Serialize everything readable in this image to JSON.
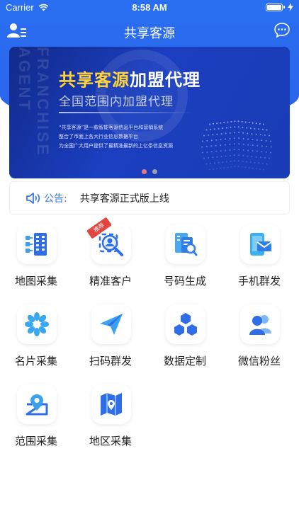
{
  "status_bar": {
    "carrier": "Carrier",
    "time": "8:58 AM",
    "battery_level": 1.0
  },
  "nav": {
    "title": "共享客源",
    "left_icon": "user-list-icon",
    "right_icon": "chat-bubble-icon"
  },
  "banner": {
    "title_highlight": "共享客源",
    "title_rest": "加盟代理",
    "subtitle": "全国范围内加盟代理",
    "vertical_text": "FRANCHISE AGENT",
    "desc_line1": "“共享客源”是一款智能客源信息平台和营销系统",
    "desc_line2": "整合了市面上各大行业信息数据平台",
    "desc_line3": "为全国广大用户提供了最精准最新的上亿条信息资源",
    "pager_count": 2,
    "pager_active": 0
  },
  "notice": {
    "icon": "speaker-icon",
    "label": "公告:",
    "text": "共享客源正式版上线"
  },
  "grid": [
    {
      "label": "地图采集",
      "icon": "map-collect-icon",
      "color": "#2f7be8"
    },
    {
      "label": "精准客户",
      "icon": "precise-customer-icon",
      "color": "#2f7be8",
      "badge": "推荐"
    },
    {
      "label": "号码生成",
      "icon": "number-generate-icon",
      "color": "#2f9be8"
    },
    {
      "label": "手机群发",
      "icon": "phone-sms-icon",
      "color": "#2fa0e8"
    },
    {
      "label": "名片采集",
      "icon": "card-collect-icon",
      "color": "#2fa0e8"
    },
    {
      "label": "扫码群发",
      "icon": "scan-send-icon",
      "color": "#2f8be8"
    },
    {
      "label": "数据定制",
      "icon": "data-custom-icon",
      "color": "#2f7be8"
    },
    {
      "label": "微信粉丝",
      "icon": "wechat-fans-icon",
      "color": "#2f7be8"
    },
    {
      "label": "范围采集",
      "icon": "range-collect-icon",
      "color": "#2f7be8"
    },
    {
      "label": "地区采集",
      "icon": "region-collect-icon",
      "color": "#2f7be8"
    }
  ]
}
